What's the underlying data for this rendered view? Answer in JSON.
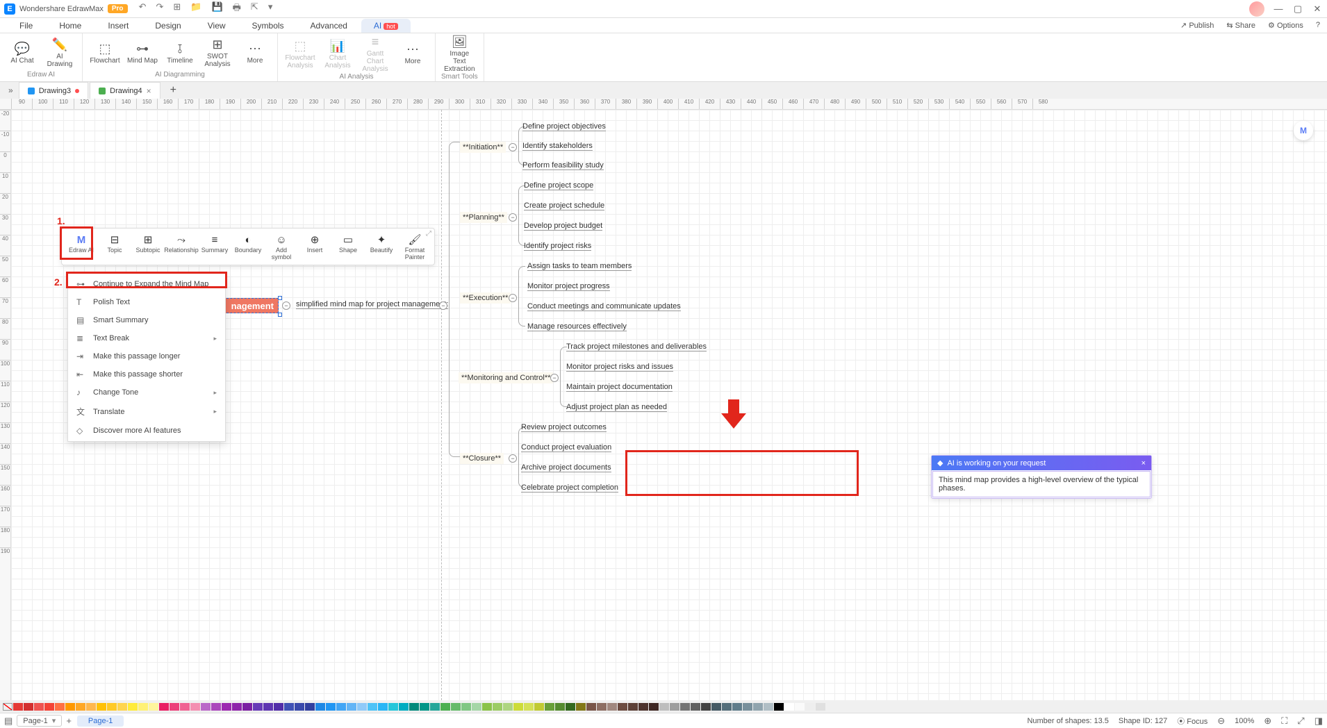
{
  "title": "Wondershare EdrawMax",
  "badge": "Pro",
  "menu": {
    "file": "File",
    "home": "Home",
    "insert": "Insert",
    "design": "Design",
    "view": "View",
    "symbols": "Symbols",
    "advanced": "Advanced",
    "ai": "AI",
    "hot": "hot"
  },
  "menuRight": {
    "publish": "Publish",
    "share": "Share",
    "options": "Options"
  },
  "ribbon": {
    "g1": {
      "name": "Edraw AI",
      "chat": "AI\nChat",
      "drawing": "AI\nDrawing"
    },
    "g2": {
      "name": "AI Diagramming",
      "flow": "Flowchart",
      "mind": "Mind\nMap",
      "timeline": "Timeline",
      "swot": "SWOT\nAnalysis",
      "more": "More"
    },
    "g3": {
      "name": "AI Analysis",
      "flowA": "Flowchart\nAnalysis",
      "chartA": "Chart\nAnalysis",
      "ganttA": "Gantt Chart\nAnalysis",
      "more": "More"
    },
    "g4": {
      "name": "Smart Tools",
      "imgtxt": "Image Text\nExtraction"
    }
  },
  "tabs": {
    "d3": "Drawing3",
    "d4": "Drawing4"
  },
  "floatTb": {
    "edrawai": "Edraw AI",
    "topic": "Topic",
    "subtopic": "Subtopic",
    "rel": "Relationship",
    "summary": "Summary",
    "boundary": "Boundary",
    "addsym": "Add symbol",
    "insert": "Insert",
    "shape": "Shape",
    "beautify": "Beautify",
    "painter": "Format\nPainter"
  },
  "ctx": {
    "expand": "Continue to Expand the Mind Map",
    "polish": "Polish Text",
    "smart": "Smart Summary",
    "tbreak": "Text Break",
    "longer": "Make this passage longer",
    "shorter": "Make this passage shorter",
    "tone": "Change Tone",
    "translate": "Translate",
    "discover": "Discover more AI features"
  },
  "annot": {
    "n1": "1.",
    "n2": "2."
  },
  "root": "nagement",
  "subtitle": "simplified mind map for project management:",
  "categories": {
    "init": {
      "label": "**Initiation**",
      "items": [
        "Define project objectives",
        "Identify stakeholders",
        "Perform feasibility study"
      ]
    },
    "plan": {
      "label": "**Planning**",
      "items": [
        "Define project scope",
        "Create project schedule",
        "Develop project budget",
        "Identify project risks"
      ]
    },
    "exec": {
      "label": "**Execution**",
      "items": [
        "Assign tasks to team members",
        "Monitor project progress",
        "Conduct meetings and communicate updates",
        "Manage resources effectively"
      ]
    },
    "mon": {
      "label": "**Monitoring and Control**",
      "items": [
        "Track project milestones and deliverables",
        "Monitor project risks and issues",
        "Maintain project documentation",
        "Adjust project plan as needed"
      ]
    },
    "close": {
      "label": "**Closure**",
      "items": [
        "Review project outcomes",
        "Conduct project evaluation",
        "Archive project documents",
        "Celebrate project completion"
      ]
    }
  },
  "ruler": {
    "h": [
      "90",
      "100",
      "110",
      "120",
      "130",
      "140",
      "150",
      "160",
      "170",
      "180",
      "190",
      "200",
      "210",
      "220",
      "230",
      "240",
      "250",
      "260",
      "270",
      "280",
      "290",
      "300",
      "310",
      "320",
      "330",
      "340",
      "350",
      "360",
      "370",
      "380",
      "390",
      "400",
      "410",
      "420",
      "430",
      "440",
      "450",
      "460",
      "470",
      "480",
      "490",
      "500",
      "510",
      "520",
      "530",
      "540",
      "550",
      "560",
      "570",
      "580"
    ],
    "v": [
      "-20",
      "-10",
      "0",
      "10",
      "20",
      "30",
      "40",
      "50",
      "60",
      "70",
      "80",
      "90",
      "100",
      "110",
      "120",
      "130",
      "140",
      "150",
      "160",
      "170",
      "180",
      "190"
    ]
  },
  "ai": {
    "head": "AI is working on your request",
    "body": "This mind map provides a high-level overview of the typical phases."
  },
  "status": {
    "page": "Page-1",
    "pagetab": "Page-1",
    "shapes": "Number of shapes: 13.5",
    "shapeid": "Shape ID: 127",
    "focus": "Focus",
    "zoom": "100%"
  },
  "palette": [
    "#e53935",
    "#d32f2f",
    "#ef5350",
    "#f44336",
    "#ff7043",
    "#ff9800",
    "#ffa726",
    "#ffb74d",
    "#ffc107",
    "#ffca28",
    "#ffd54f",
    "#ffeb3b",
    "#fff176",
    "#fff59d",
    "#e91e63",
    "#ec407a",
    "#f06292",
    "#f48fb1",
    "#ba68c8",
    "#ab47bc",
    "#9c27b0",
    "#8e24aa",
    "#7b1fa2",
    "#673ab7",
    "#5e35b1",
    "#512da8",
    "#3f51b5",
    "#3949ab",
    "#303f9f",
    "#1e88e5",
    "#2196f3",
    "#42a5f5",
    "#64b5f6",
    "#90caf9",
    "#4fc3f7",
    "#29b6f6",
    "#26c6da",
    "#00acc1",
    "#00897b",
    "#009688",
    "#26a69a",
    "#4caf50",
    "#66bb6a",
    "#81c784",
    "#a5d6a7",
    "#8bc34a",
    "#9ccc65",
    "#aed581",
    "#cddc39",
    "#d4e157",
    "#c0ca33",
    "#689f38",
    "#558b2f",
    "#33691e",
    "#827717",
    "#795548",
    "#8d6e63",
    "#a1887f",
    "#6d4c41",
    "#5d4037",
    "#4e342e",
    "#3e2723",
    "#bdbdbd",
    "#9e9e9e",
    "#757575",
    "#616161",
    "#424242",
    "#455a64",
    "#546e7a",
    "#607d8b",
    "#78909c",
    "#90a4ae",
    "#b0bec5",
    "#000000",
    "#ffffff",
    "#fafafa",
    "#eeeeee",
    "#e0e0e0"
  ]
}
